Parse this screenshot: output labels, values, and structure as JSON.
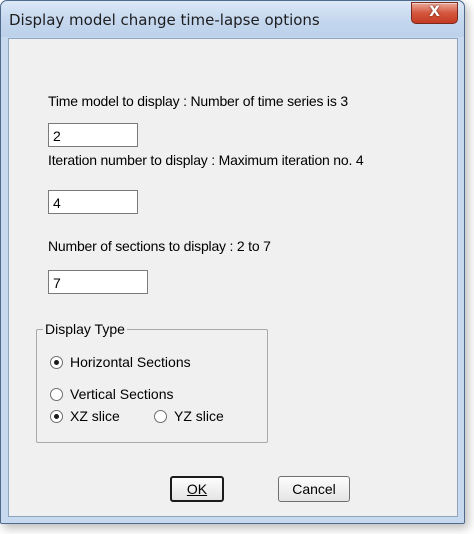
{
  "window": {
    "title": "Display model change time-lapse options",
    "close_label": "X"
  },
  "fields": {
    "time_model": {
      "label": "Time model to display : Number of time series is 3",
      "value": "2"
    },
    "iteration": {
      "label": "Iteration number to display : Maximum iteration no. 4",
      "value": "4"
    },
    "sections": {
      "label": "Number of sections to display : 2 to 7",
      "value": "7"
    }
  },
  "display_type": {
    "legend": "Display Type",
    "options": [
      {
        "label": "Horizontal Sections",
        "checked": true
      },
      {
        "label": "Vertical Sections",
        "checked": false
      }
    ],
    "slice_options": [
      {
        "label": "XZ slice",
        "checked": true
      },
      {
        "label": "YZ slice",
        "checked": false
      }
    ]
  },
  "buttons": {
    "ok": "OK",
    "cancel": "Cancel"
  }
}
